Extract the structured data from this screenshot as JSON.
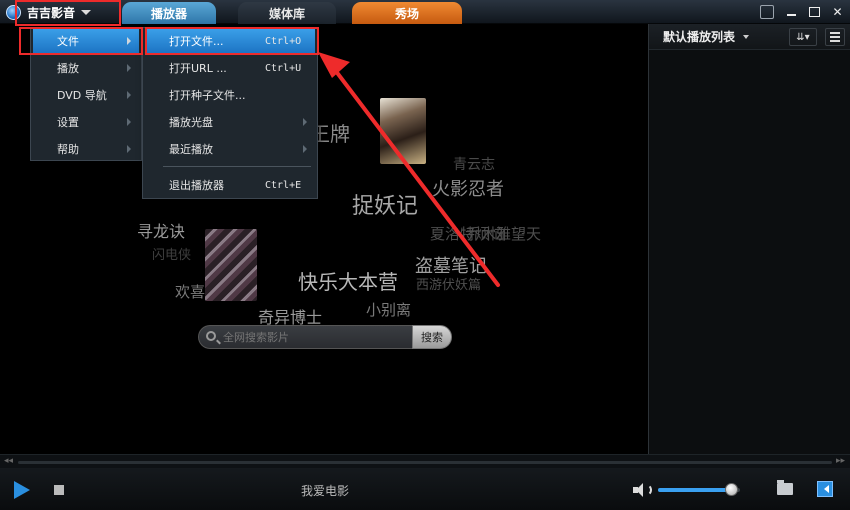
{
  "app": {
    "name": "吉吉影音",
    "logo_icon": "globe-icon",
    "accent_color": "#2a8fe0"
  },
  "tabs": [
    {
      "label": "播放器",
      "color": "#3f8fc4",
      "active": true
    },
    {
      "label": "媒体库",
      "color": "#27303a",
      "active": false
    },
    {
      "label": "秀场",
      "color": "#e07320",
      "active": false
    }
  ],
  "window_controls": [
    "skin-icon",
    "minimize-icon",
    "maximize-icon",
    "close-icon"
  ],
  "main_menu": [
    {
      "label": "文件",
      "has_submenu": true,
      "active": true
    },
    {
      "label": "播放",
      "has_submenu": true,
      "active": false
    },
    {
      "label": "DVD 导航",
      "has_submenu": true,
      "active": false
    },
    {
      "label": "设置",
      "has_submenu": true,
      "active": false
    },
    {
      "label": "帮助",
      "has_submenu": true,
      "active": false
    }
  ],
  "file_submenu": [
    {
      "label": "打开文件...",
      "shortcut": "Ctrl+O",
      "has_submenu": false
    },
    {
      "label": "打开URL ...",
      "shortcut": "Ctrl+U",
      "has_submenu": false
    },
    {
      "label": "打开种子文件...",
      "shortcut": "",
      "has_submenu": false
    },
    {
      "label": "播放光盘",
      "shortcut": "",
      "has_submenu": true
    },
    {
      "label": "最近播放",
      "shortcut": "",
      "has_submenu": true
    },
    {
      "label": "退出播放器",
      "shortcut": "Ctrl+E",
      "has_submenu": false
    }
  ],
  "tag_cloud": [
    {
      "text": "王牌",
      "color": "#8a8a8a"
    },
    {
      "text": "青云志",
      "color": "#4a4a4a"
    },
    {
      "text": "火影忍者",
      "color": "#8e8e8e"
    },
    {
      "text": "捉妖记",
      "color": "#a8a8a8"
    },
    {
      "text": "寻龙诀",
      "color": "#9a9a9a"
    },
    {
      "text": "夏洛特烦恼",
      "color": "#4e4e4e"
    },
    {
      "text": "乔木雅望天",
      "color": "#4e4e4e"
    },
    {
      "text": "闪电侠",
      "color": "#3e3e3e"
    },
    {
      "text": "快乐大本营",
      "color": "#b8b8b8"
    },
    {
      "text": "盗墓笔记",
      "color": "#a0a0a0"
    },
    {
      "text": "西游伏妖篇",
      "color": "#4e4e4e"
    },
    {
      "text": "欢喜",
      "color": "#7a7a7a"
    },
    {
      "text": "奇异博士",
      "color": "#9a9a9a"
    },
    {
      "text": "小别离",
      "color": "#7a7a7a"
    }
  ],
  "search": {
    "placeholder": "全网搜索影片",
    "button_label": "搜索"
  },
  "playlist": {
    "title": "默认播放列表",
    "sort_label": "⇊▾"
  },
  "player": {
    "now_playing": "我爱电影",
    "volume": 0.9
  }
}
